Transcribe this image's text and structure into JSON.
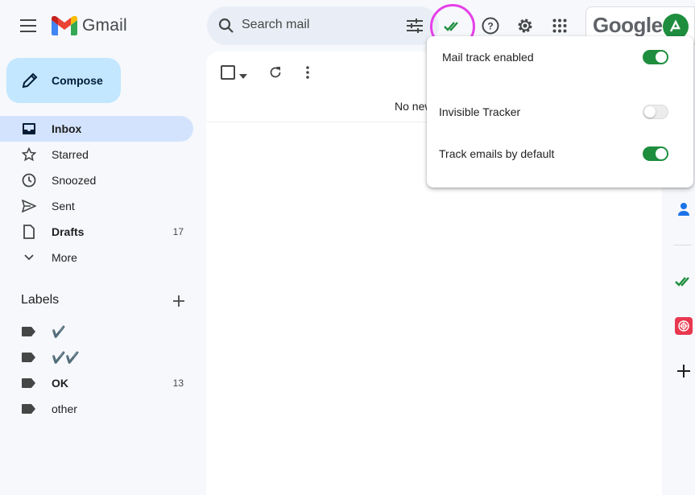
{
  "header": {
    "app_name": "Gmail",
    "search_placeholder": "Search mail",
    "account_brand": "Google"
  },
  "compose": {
    "label": "Compose"
  },
  "nav": [
    {
      "label": "Inbox",
      "count": "",
      "active": true
    },
    {
      "label": "Starred",
      "count": ""
    },
    {
      "label": "Snoozed",
      "count": ""
    },
    {
      "label": "Sent",
      "count": ""
    },
    {
      "label": "Drafts",
      "count": "17"
    },
    {
      "label": "More",
      "count": ""
    }
  ],
  "labels": {
    "heading": "Labels",
    "items": [
      {
        "label": "✔️",
        "count": ""
      },
      {
        "label": "✔️✔️",
        "count": ""
      },
      {
        "label": "OK",
        "count": "13"
      },
      {
        "label": "other",
        "count": ""
      }
    ]
  },
  "main": {
    "empty_text": "No new"
  },
  "mailtrack_popup": {
    "items": [
      {
        "label": "Mail track enabled",
        "enabled": true
      },
      {
        "label": "Invisible Tracker",
        "enabled": false
      },
      {
        "label": "Track emails by default",
        "enabled": true
      }
    ]
  },
  "colors": {
    "accent_green": "#1e8e3e",
    "highlight_ring": "#e63fe8",
    "active_nav": "#d3e3fd",
    "compose_bg": "#c2e7ff"
  },
  "icons": {
    "menu": "hamburger-icon",
    "search": "search-icon",
    "filter": "tune-icon",
    "mailtrack": "double-check-icon",
    "help": "help-icon",
    "settings": "gear-icon",
    "apps": "apps-grid-icon"
  }
}
